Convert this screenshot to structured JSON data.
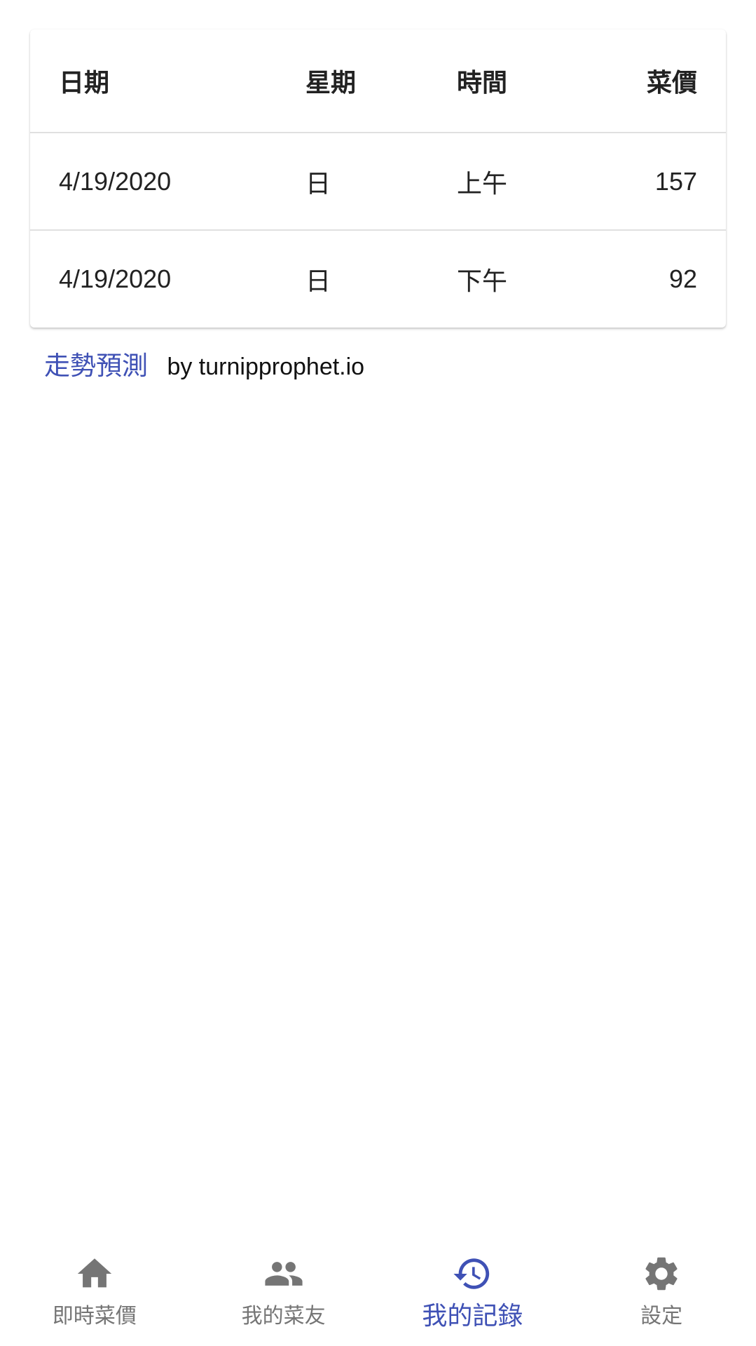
{
  "table": {
    "headers": [
      "日期",
      "星期",
      "時間",
      "菜價"
    ],
    "rows": [
      [
        "4/19/2020",
        "日",
        "上午",
        "157"
      ],
      [
        "4/19/2020",
        "日",
        "下午",
        "92"
      ]
    ]
  },
  "prediction": {
    "link_label": "走勢預測",
    "by_text": "by turnipprophet.io"
  },
  "bottom_nav": {
    "items": [
      {
        "label": "即時菜價",
        "icon": "home-icon",
        "active": false
      },
      {
        "label": "我的菜友",
        "icon": "people-icon",
        "active": false
      },
      {
        "label": "我的記錄",
        "icon": "history-icon",
        "active": true
      },
      {
        "label": "設定",
        "icon": "gear-icon",
        "active": false
      }
    ]
  },
  "colors": {
    "accent": "#3f51b5",
    "inactive": "#757575",
    "divider": "#e0e0e0"
  }
}
